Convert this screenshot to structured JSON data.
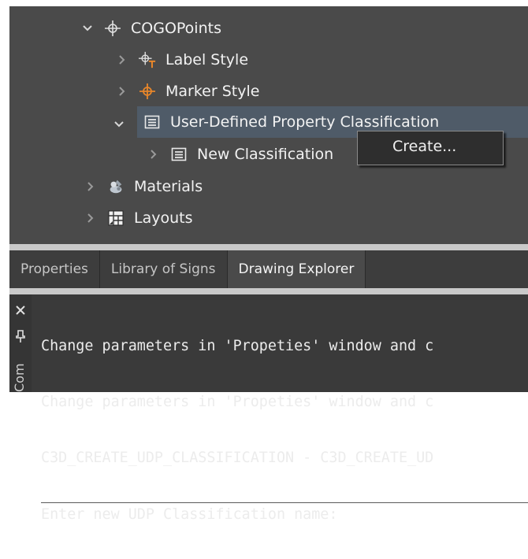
{
  "tree": {
    "items": [
      {
        "label": "COGOPoints",
        "expanded": true,
        "icon": "cogo-points-icon"
      },
      {
        "label": "Label Style",
        "expanded": false,
        "icon": "label-style-icon"
      },
      {
        "label": "Marker Style",
        "expanded": false,
        "icon": "marker-style-icon"
      },
      {
        "label": "User-Defined Property Classification",
        "expanded": true,
        "selected": true,
        "icon": "classification-list-icon"
      },
      {
        "label": "New Classification",
        "expanded": false,
        "icon": "classification-list-icon"
      },
      {
        "label": "Materials",
        "expanded": false,
        "icon": "materials-icon"
      },
      {
        "label": "Layouts",
        "expanded": false,
        "icon": "layouts-icon"
      }
    ]
  },
  "context_menu": {
    "items": [
      {
        "label": "Create..."
      }
    ]
  },
  "tabs": [
    {
      "label": "Properties",
      "active": false
    },
    {
      "label": "Library of Signs",
      "active": false
    },
    {
      "label": "Drawing Explorer",
      "active": true
    }
  ],
  "command_panel": {
    "vertical_label": "Com",
    "lines": [
      "Change parameters in 'Propeties' window and c",
      "Change parameters in 'Propeties' window and c",
      "C3D_CREATE_UDP_CLASSIFICATION - C3D_CREATE_UD",
      "Enter new UDP Classification name:"
    ]
  },
  "colors": {
    "panel_bg": "#4a4a4a",
    "selection": "#4f5b68",
    "marker_orange": "#e8862a"
  }
}
